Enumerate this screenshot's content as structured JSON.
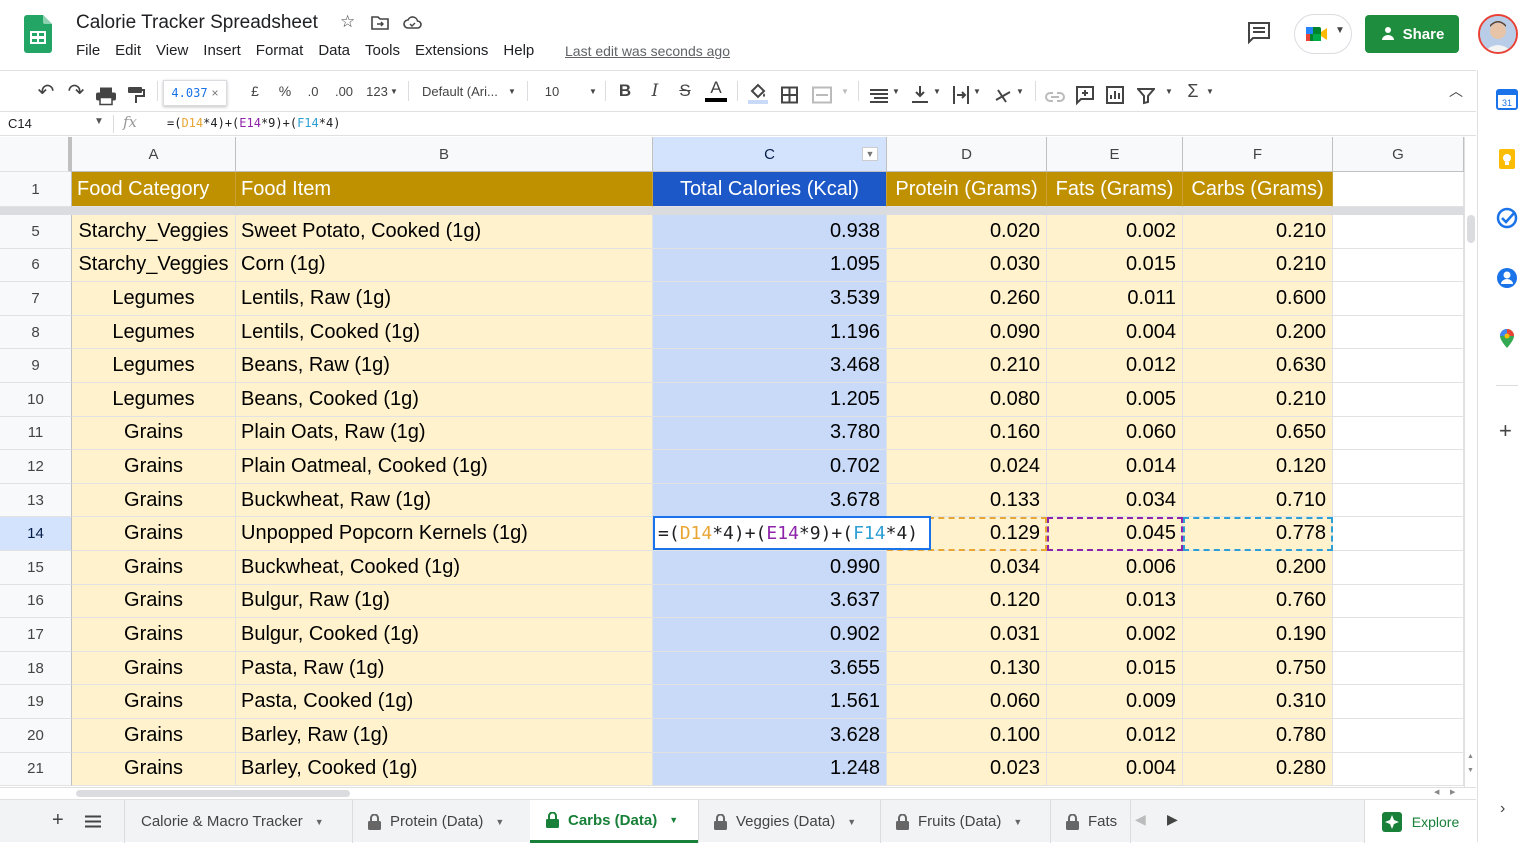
{
  "app": {
    "title": "Calorie Tracker Spreadsheet",
    "menu": [
      "File",
      "Edit",
      "View",
      "Insert",
      "Format",
      "Data",
      "Tools",
      "Extensions",
      "Help"
    ],
    "last_edit": "Last edit was seconds ago",
    "share_label": "Share"
  },
  "toolbar": {
    "tooltip_value": "4.037",
    "currency": "£",
    "percent": "%",
    "dec_decrease": ".0",
    "dec_increase": ".00",
    "number_format": "123",
    "font": "Default (Ari...",
    "font_size": "10",
    "bold": "B",
    "italic": "I",
    "strike": "S",
    "text_color": "A"
  },
  "formula_bar": {
    "cell_ref": "C14",
    "fx": "fx",
    "formula": [
      {
        "t": "=(",
        "c": "dk"
      },
      {
        "t": "D14",
        "c": "orange"
      },
      {
        "t": "*4)+(",
        "c": "dk"
      },
      {
        "t": "E14",
        "c": "purple"
      },
      {
        "t": "*9)+(",
        "c": "dk"
      },
      {
        "t": "F14",
        "c": "blue"
      },
      {
        "t": "*4)",
        "c": "dk"
      }
    ]
  },
  "grid": {
    "columns": [
      "A",
      "B",
      "C",
      "D",
      "E",
      "F",
      "G"
    ],
    "selected_column": "C",
    "selected_row": "14",
    "header_row": {
      "row_num": "1",
      "cells": [
        "Food Category",
        "Food Item",
        "Total Calories (Kcal)",
        "Protein (Grams)",
        "Fats (Grams)",
        "Carbs (Grams)"
      ]
    },
    "rows": [
      {
        "n": "5",
        "cat": "Starchy_Veggies",
        "item": "Sweet Potato, Cooked (1g)",
        "kcal": "0.938",
        "protein": "0.020",
        "fats": "0.002",
        "carbs": "0.210"
      },
      {
        "n": "6",
        "cat": "Starchy_Veggies",
        "item": "Corn (1g)",
        "kcal": "1.095",
        "protein": "0.030",
        "fats": "0.015",
        "carbs": "0.210"
      },
      {
        "n": "7",
        "cat": "Legumes",
        "item": "Lentils, Raw (1g)",
        "kcal": "3.539",
        "protein": "0.260",
        "fats": "0.011",
        "carbs": "0.600"
      },
      {
        "n": "8",
        "cat": "Legumes",
        "item": "Lentils, Cooked (1g)",
        "kcal": "1.196",
        "protein": "0.090",
        "fats": "0.004",
        "carbs": "0.200"
      },
      {
        "n": "9",
        "cat": "Legumes",
        "item": "Beans, Raw (1g)",
        "kcal": "3.468",
        "protein": "0.210",
        "fats": "0.012",
        "carbs": "0.630"
      },
      {
        "n": "10",
        "cat": "Legumes",
        "item": "Beans, Cooked (1g)",
        "kcal": "1.205",
        "protein": "0.080",
        "fats": "0.005",
        "carbs": "0.210"
      },
      {
        "n": "11",
        "cat": "Grains",
        "item": "Plain Oats, Raw (1g)",
        "kcal": "3.780",
        "protein": "0.160",
        "fats": "0.060",
        "carbs": "0.650"
      },
      {
        "n": "12",
        "cat": "Grains",
        "item": "Plain Oatmeal, Cooked (1g)",
        "kcal": "0.702",
        "protein": "0.024",
        "fats": "0.014",
        "carbs": "0.120"
      },
      {
        "n": "13",
        "cat": "Grains",
        "item": "Buckwheat, Raw (1g)",
        "kcal": "3.678",
        "protein": "0.133",
        "fats": "0.034",
        "carbs": "0.710"
      },
      {
        "n": "14",
        "cat": "Grains",
        "item": "Unpopped Popcorn Kernels (1g)",
        "kcal": "",
        "protein": "0.129",
        "fats": "0.045",
        "carbs": "0.778"
      },
      {
        "n": "15",
        "cat": "Grains",
        "item": "Buckwheat, Cooked (1g)",
        "kcal": "0.990",
        "protein": "0.034",
        "fats": "0.006",
        "carbs": "0.200"
      },
      {
        "n": "16",
        "cat": "Grains",
        "item": "Bulgur, Raw (1g)",
        "kcal": "3.637",
        "protein": "0.120",
        "fats": "0.013",
        "carbs": "0.760"
      },
      {
        "n": "17",
        "cat": "Grains",
        "item": "Bulgur, Cooked (1g)",
        "kcal": "0.902",
        "protein": "0.031",
        "fats": "0.002",
        "carbs": "0.190"
      },
      {
        "n": "18",
        "cat": "Grains",
        "item": "Pasta, Raw (1g)",
        "kcal": "3.655",
        "protein": "0.130",
        "fats": "0.015",
        "carbs": "0.750"
      },
      {
        "n": "19",
        "cat": "Grains",
        "item": "Pasta, Cooked (1g)",
        "kcal": "1.561",
        "protein": "0.060",
        "fats": "0.009",
        "carbs": "0.310"
      },
      {
        "n": "20",
        "cat": "Grains",
        "item": "Barley, Raw (1g)",
        "kcal": "3.628",
        "protein": "0.100",
        "fats": "0.012",
        "carbs": "0.780"
      },
      {
        "n": "21",
        "cat": "Grains",
        "item": "Barley, Cooked (1g)",
        "kcal": "1.248",
        "protein": "0.023",
        "fats": "0.004",
        "carbs": "0.280"
      }
    ]
  },
  "tabs": [
    {
      "label": "Calorie & Macro Tracker",
      "locked": false,
      "active": false
    },
    {
      "label": "Protein (Data)",
      "locked": true,
      "active": false
    },
    {
      "label": "Carbs (Data)",
      "locked": true,
      "active": true
    },
    {
      "label": "Veggies (Data)",
      "locked": true,
      "active": false
    },
    {
      "label": "Fruits (Data)",
      "locked": true,
      "active": false
    },
    {
      "label": "Fats",
      "locked": true,
      "active": false
    }
  ],
  "explore_label": "Explore",
  "colors": {
    "header_gold": "#bf9000",
    "header_blue": "#1c58c8",
    "cell_yellow": "#fff2cc",
    "cell_blue": "#c9daf8",
    "share_green": "#1e8e3e",
    "selection_blue": "#1a73e8"
  }
}
